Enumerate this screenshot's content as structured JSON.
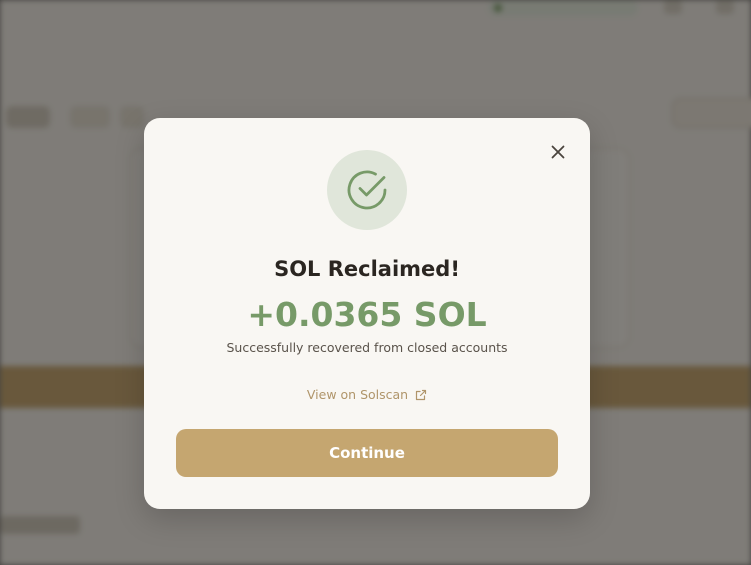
{
  "modal": {
    "title": "SOL Reclaimed!",
    "amount": "+0.0365 SOL",
    "subtitle": "Successfully recovered from closed accounts",
    "link_label": "View on Solscan",
    "continue_label": "Continue",
    "close_icon": "close-icon",
    "success_icon": "check-circle-icon",
    "link_icon": "external-link-icon"
  },
  "colors": {
    "accent": "#c5a670",
    "success": "#779a68",
    "success_bg": "#e0e6da",
    "modal_bg": "#f9f7f3",
    "title": "#2b2621",
    "link": "#b0956a"
  }
}
